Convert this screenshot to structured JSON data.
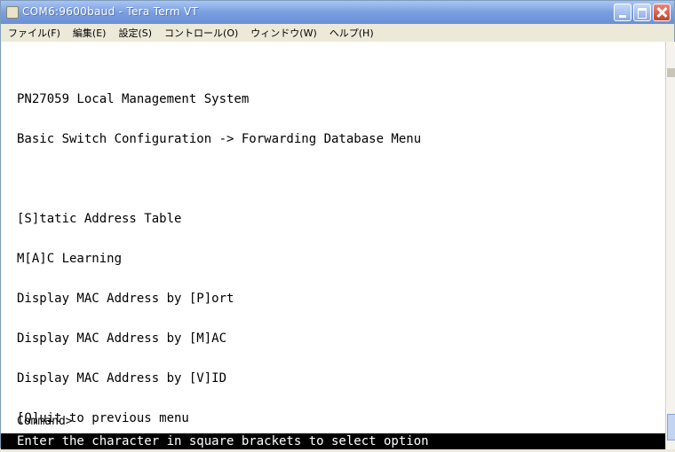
{
  "window": {
    "title": "COM6:9600baud - Tera Term VT"
  },
  "menu": {
    "items": [
      {
        "label": "ファイル(F)"
      },
      {
        "label": "編集(E)"
      },
      {
        "label": "設定(S)"
      },
      {
        "label": "コントロール(O)"
      },
      {
        "label": "ウィンドウ(W)"
      },
      {
        "label": "ヘルプ(H)"
      }
    ]
  },
  "terminal": {
    "lines": [
      "PN27059 Local Management System",
      "Basic Switch Configuration -> Forwarding Database Menu",
      "",
      "[S]tatic Address Table",
      "M[A]C Learning",
      "Display MAC Address by [P]ort",
      "Display MAC Address by [M]AC",
      "Display MAC Address by [V]ID",
      "[Q]uit to previous menu"
    ],
    "prompt": "Command>",
    "status": "Enter the character in square brackets to select option"
  },
  "icons": {
    "app": "terminal-icon",
    "minimize": "minimize-icon",
    "maximize": "maximize-icon",
    "close": "close-icon"
  },
  "colors": {
    "titlebar": "#7a9fe0",
    "terminal_bg": "#ffffff",
    "terminal_fg": "#000000",
    "status_bg": "#000000",
    "status_fg": "#ffffff",
    "close_button": "#c3422c"
  }
}
